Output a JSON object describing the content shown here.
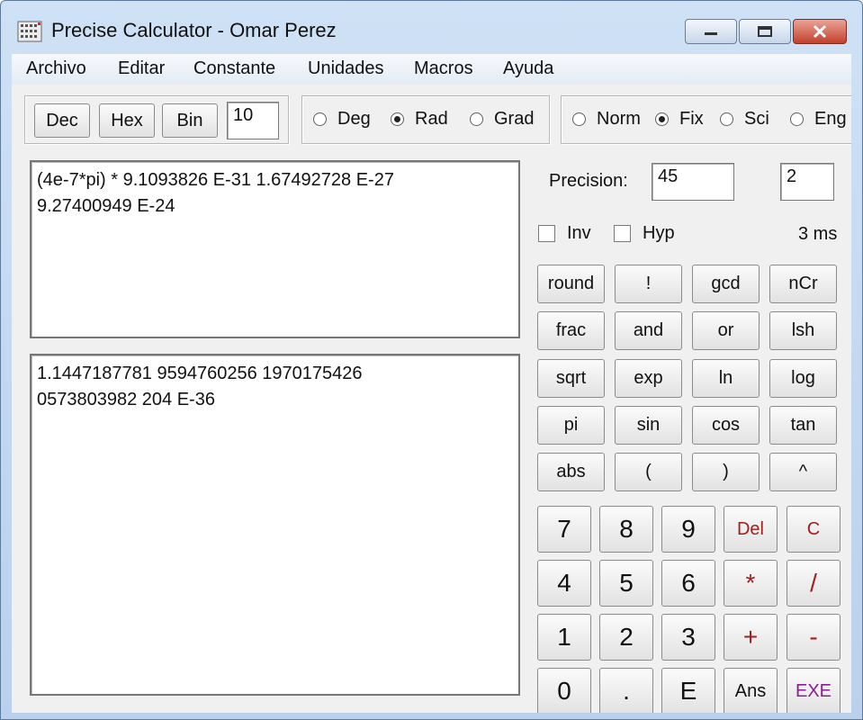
{
  "window": {
    "title": "Precise Calculator - Omar Perez"
  },
  "menu": [
    "Archivo",
    "Editar",
    "Constante",
    "Unidades",
    "Macros",
    "Ayuda"
  ],
  "base": {
    "buttons": [
      "Dec",
      "Hex",
      "Bin"
    ],
    "value": "10"
  },
  "angle": {
    "options": [
      "Deg",
      "Rad",
      "Grad"
    ],
    "selected": "Rad"
  },
  "format": {
    "options": [
      "Norm",
      "Fix",
      "Sci",
      "Eng"
    ],
    "selected": "Fix"
  },
  "expression": "(4e-7*pi) * 9.1093826 E-31 1.67492728 E-27\n9.27400949 E-24",
  "result": "1.1447187781 9594760256 1970175426\n0573803982 204 E-36",
  "precision": {
    "label": "Precision:",
    "value": "45",
    "digits": "2"
  },
  "toggles": {
    "inv": "Inv",
    "hyp": "Hyp"
  },
  "timing": "3 ms",
  "functions": [
    [
      "round",
      "!",
      "gcd",
      "nCr"
    ],
    [
      "frac",
      "and",
      "or",
      "lsh"
    ],
    [
      "sqrt",
      "exp",
      "ln",
      "log"
    ],
    [
      "pi",
      "sin",
      "cos",
      "tan"
    ],
    [
      "abs",
      "(",
      ")",
      "^"
    ]
  ],
  "keypad": [
    [
      "7",
      "8",
      "9",
      "Del",
      "C"
    ],
    [
      "4",
      "5",
      "6",
      "*",
      "/"
    ],
    [
      "1",
      "2",
      "3",
      "+",
      "-"
    ],
    [
      "0",
      ".",
      "E",
      "Ans",
      "EXE"
    ]
  ],
  "colors": {
    "operator": "#a11f1f",
    "exe": "#8a1f8f",
    "close": "#c4402c"
  }
}
